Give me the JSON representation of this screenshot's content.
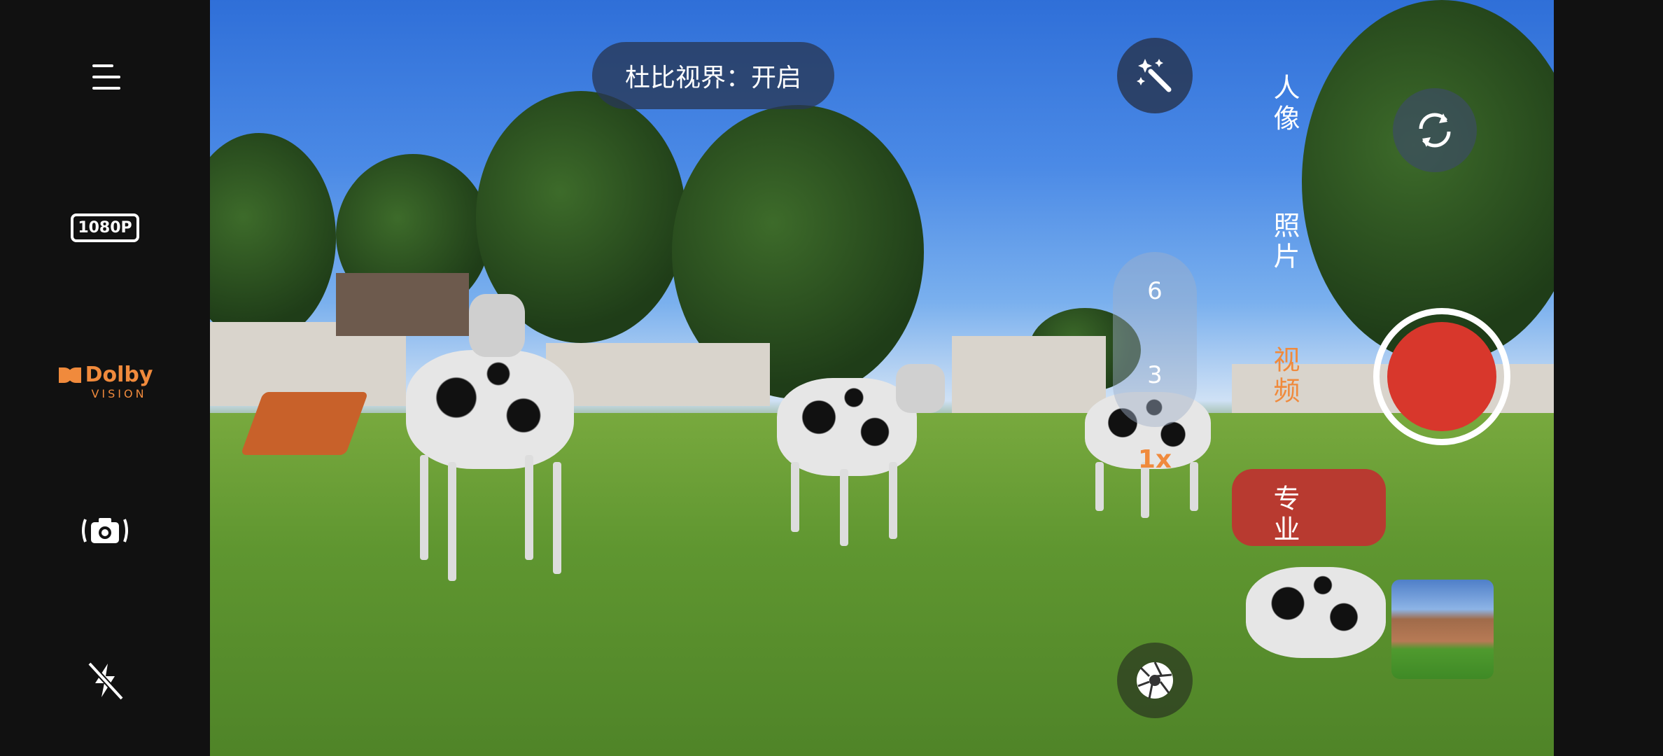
{
  "left_bar": {
    "menu_icon": "menu-icon",
    "resolution_label": "1080P",
    "dolby_label": "Dolby",
    "dolby_sub": "VISION",
    "camera_switch_icon": "camera-stabilizer-icon",
    "flash_icon": "flash-off-icon"
  },
  "viewfinder": {
    "dolby_toast": "杜比视界：开启",
    "zoom_levels": [
      "6",
      "3"
    ],
    "zoom_current": "1x"
  },
  "modes": {
    "portrait": "人像",
    "photo": "照片",
    "video": "视频",
    "pro": "专业"
  },
  "colors": {
    "accent": "#f08a3c",
    "record": "#d8372c"
  }
}
